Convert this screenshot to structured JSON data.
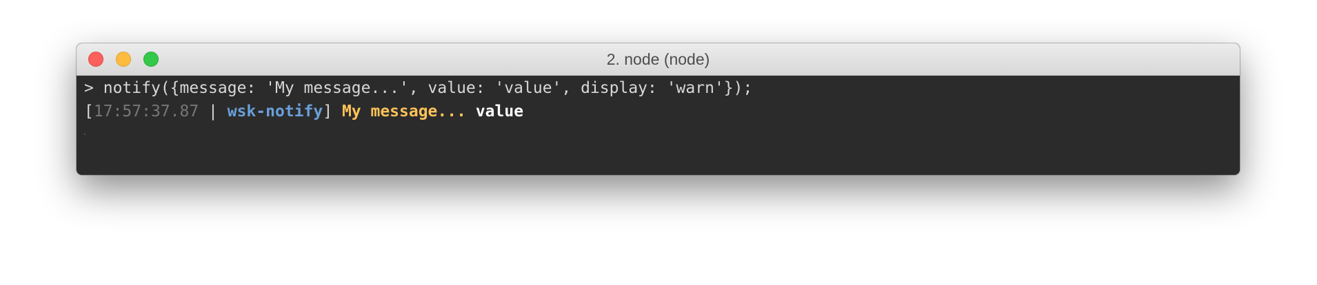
{
  "window": {
    "title": "2. node (node)"
  },
  "terminal": {
    "prompt": ">",
    "command": "notify({message: 'My message...', value: 'value', display: 'warn'});",
    "output": {
      "bracket_open": "[",
      "timestamp": "17:57:37.87",
      "separator": " | ",
      "tag": "wsk-notify",
      "bracket_close": "]",
      "message": "My message...",
      "value": "value"
    }
  },
  "colors": {
    "terminal_bg": "#2b2b2b",
    "timestamp": "#777777",
    "tag": "#6a9fd9",
    "message": "#fdc25a",
    "value": "#ffffff"
  }
}
